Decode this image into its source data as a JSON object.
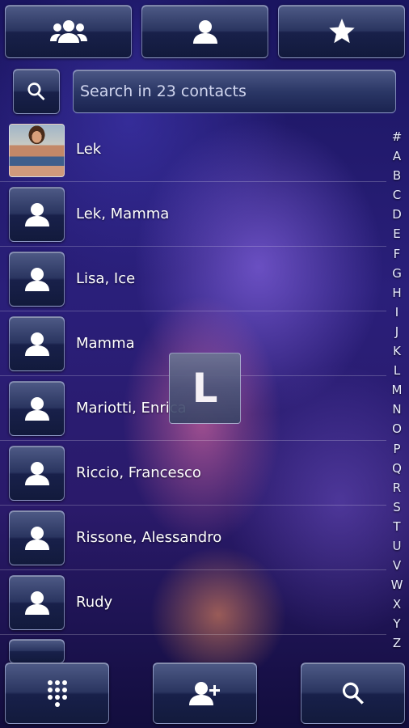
{
  "top_tabs": [
    {
      "icon": "group-icon",
      "name": "tab-groups"
    },
    {
      "icon": "person-icon",
      "name": "tab-contacts"
    },
    {
      "icon": "star-icon",
      "name": "tab-favorites"
    }
  ],
  "search": {
    "placeholder": "Search in 23 contacts",
    "value": ""
  },
  "contacts": [
    {
      "name": "Lek",
      "avatar": "photo"
    },
    {
      "name": "Lek, Mamma",
      "avatar": "person-icon"
    },
    {
      "name": "Lisa, Ice",
      "avatar": "person-icon"
    },
    {
      "name": "Mamma",
      "avatar": "person-icon"
    },
    {
      "name": "Mariotti, Enrica",
      "avatar": "person-icon"
    },
    {
      "name": "Riccio, Francesco",
      "avatar": "person-icon"
    },
    {
      "name": "Rissone, Alessandro",
      "avatar": "person-icon"
    },
    {
      "name": "Rudy",
      "avatar": "person-icon"
    }
  ],
  "alphabet_index": [
    "#",
    "A",
    "B",
    "C",
    "D",
    "E",
    "F",
    "G",
    "H",
    "I",
    "J",
    "K",
    "L",
    "M",
    "N",
    "O",
    "P",
    "Q",
    "R",
    "S",
    "T",
    "U",
    "V",
    "W",
    "X",
    "Y",
    "Z"
  ],
  "scroll_letter": "L",
  "bottom_bar": [
    {
      "icon": "dialpad-icon",
      "name": "dialpad-button"
    },
    {
      "icon": "add-contact-icon",
      "name": "add-contact-button"
    },
    {
      "icon": "search-icon",
      "name": "search-button"
    }
  ],
  "colors": {
    "accent_button": "#2a3560",
    "background": "#2a1f7a"
  }
}
